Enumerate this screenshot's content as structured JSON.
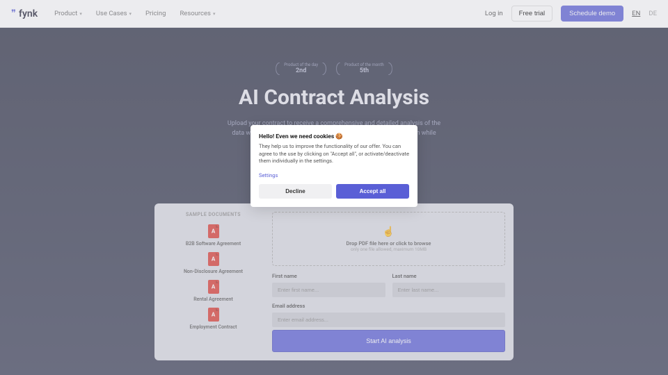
{
  "nav": {
    "brand": "fynk",
    "items": [
      "Product",
      "Use Cases",
      "Pricing",
      "Resources"
    ],
    "login": "Log in",
    "trial": "Free trial",
    "demo": "Schedule demo",
    "langs": [
      "EN",
      "DE"
    ]
  },
  "hero": {
    "badges": [
      {
        "label": "Product of the day",
        "value": "2nd"
      },
      {
        "label": "Product of the month",
        "value": "5th"
      }
    ],
    "title": "AI Contract Analysis",
    "subtitle": "Upload your contract to receive a comprehensive and detailed analysis of the data within. Learn how fynk's AI model pinpoints crucial information while extracting"
  },
  "samples": {
    "heading": "SAMPLE DOCUMENTS",
    "items": [
      "B2B Software Agreement",
      "Non-Disclosure Agreement",
      "Rental Agreement",
      "Employment Contract"
    ]
  },
  "form": {
    "drop_main": "Drop PDF file here or click to browse",
    "drop_sub": "only one file allowed, maximum 10MB",
    "first": "First name",
    "first_ph": "Enter first name...",
    "last": "Last name",
    "last_ph": "Enter last name...",
    "email": "Email address",
    "email_ph": "Enter email address...",
    "submit": "Start AI analysis"
  },
  "cookie": {
    "title": "Hello! Even we need cookies 🍪",
    "body": "They help us to improve the functionality of our offer. You can agree to the use by clicking on \"Accept all\", or activate/deactivate them individually in the settings.",
    "settings": "Settings",
    "decline": "Decline",
    "accept": "Accept all"
  }
}
